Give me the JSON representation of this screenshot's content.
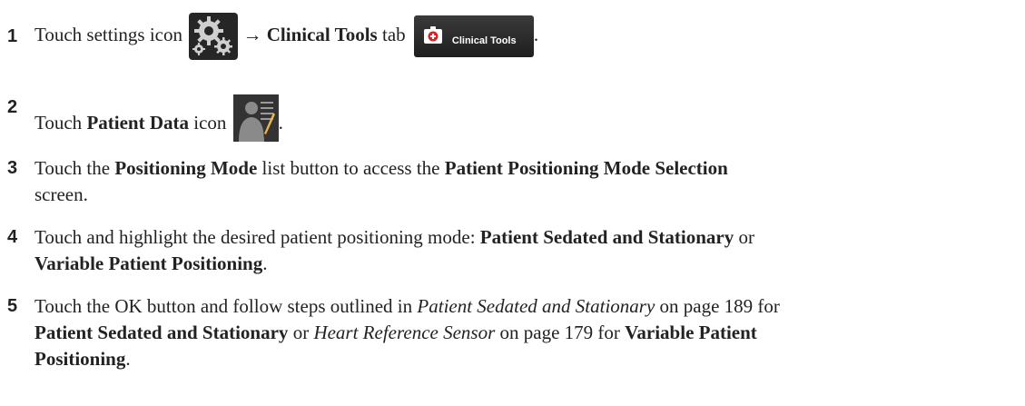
{
  "steps": [
    {
      "number": "1",
      "pre": "Touch settings icon ",
      "arrow": "→",
      "bold1": "Clinical Tools",
      "post": " tab ",
      "tab_label": "Clinical Tools",
      "end": "."
    },
    {
      "number": "2",
      "pre": "Touch ",
      "bold1": "Patient Data",
      "post": " icon ",
      "end": "."
    },
    {
      "number": "3",
      "pre": "Touch the ",
      "bold1": "Positioning Mode",
      "mid": " list button to access the ",
      "bold2": "Patient Positioning Mode Selection",
      "line2": "screen."
    },
    {
      "number": "4",
      "pre": "Touch and highlight the desired patient positioning mode: ",
      "bold1": "Patient Sedated and Stationary",
      "mid": " or",
      "bold2": "Variable Patient Positioning",
      "end": "."
    },
    {
      "number": "5",
      "pre": "Touch the OK button and follow steps outlined in ",
      "ital1": "Patient Sedated and Stationary",
      "mid1": " on page 189 for",
      "bold1": "Patient Sedated and Stationary",
      "mid2": " or ",
      "ital2": "Heart Reference Sensor",
      "mid3": " on page 179 for ",
      "bold2": "Variable Patient",
      "bold3": "Positioning",
      "end": "."
    }
  ],
  "icons": {
    "gear": "settings-gear-icon",
    "medkit": "medical-kit-icon",
    "patient": "patient-data-icon"
  },
  "colors": {
    "icon_bg": "#262626",
    "medkit_red": "#d8232a",
    "gear_silver": "#cfcfcf"
  }
}
